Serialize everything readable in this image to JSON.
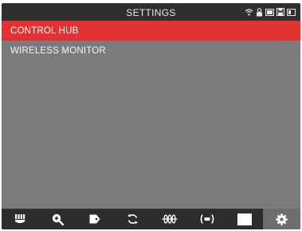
{
  "header": {
    "title": "SETTINGS",
    "status_icons": [
      "wifi-icon",
      "person-lock-icon",
      "battery-icon",
      "save-icon",
      "battery-low-icon"
    ]
  },
  "menu": {
    "items": [
      {
        "label": "CONTROL HUB",
        "selected": true
      },
      {
        "label": "WIRELESS MONITOR",
        "selected": false
      }
    ]
  },
  "toolbar": {
    "tools": [
      {
        "icon": "tire-tread-icon",
        "active": false
      },
      {
        "icon": "zoom-in-icon",
        "active": false
      },
      {
        "icon": "tag-icon",
        "active": false
      },
      {
        "icon": "refresh-icon",
        "active": false
      },
      {
        "icon": "coil-icon",
        "active": false
      },
      {
        "icon": "broadcast-icon",
        "active": false
      },
      {
        "icon": "blank-square-icon",
        "active": false
      },
      {
        "icon": "gear-icon",
        "active": true
      }
    ]
  },
  "colors": {
    "background": "#7a7b7c",
    "titlebar": "#2e2f31",
    "selected": "#e23232",
    "toolbar": "#2c2d2f",
    "toolbar_active": "#6c6d6f"
  }
}
